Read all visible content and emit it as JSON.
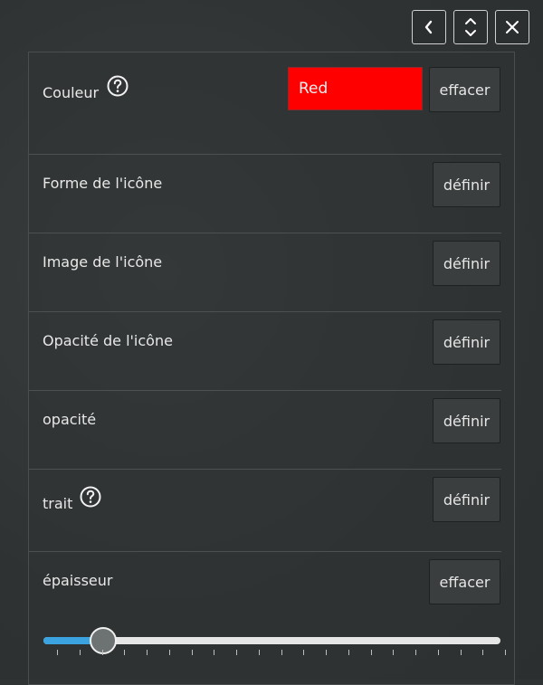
{
  "colors": {
    "color_swatch": "#ff0000",
    "slider_fill": "#3aa3e0"
  },
  "toolbar": {
    "prev_icon": "chevron-left-icon",
    "collapse_icon": "chevron-up-down-icon",
    "close_icon": "close-icon"
  },
  "rows": {
    "couleur": {
      "label": "Couleur",
      "value": "Red",
      "button": "effacer",
      "help_icon": "question-circle-icon"
    },
    "forme": {
      "label": "Forme de l'icône",
      "button": "définir"
    },
    "image": {
      "label": "Image de l'icône",
      "button": "définir"
    },
    "opacite_icone": {
      "label": "Opacité de l'icône",
      "button": "définir"
    },
    "opacite": {
      "label": "opacité",
      "button": "définir"
    },
    "trait": {
      "label": "trait",
      "button": "définir",
      "help_icon": "question-circle-icon"
    },
    "epaisseur": {
      "label": "épaisseur",
      "button": "effacer"
    }
  },
  "slider": {
    "fraction": 0.13,
    "tick_count": 21
  }
}
